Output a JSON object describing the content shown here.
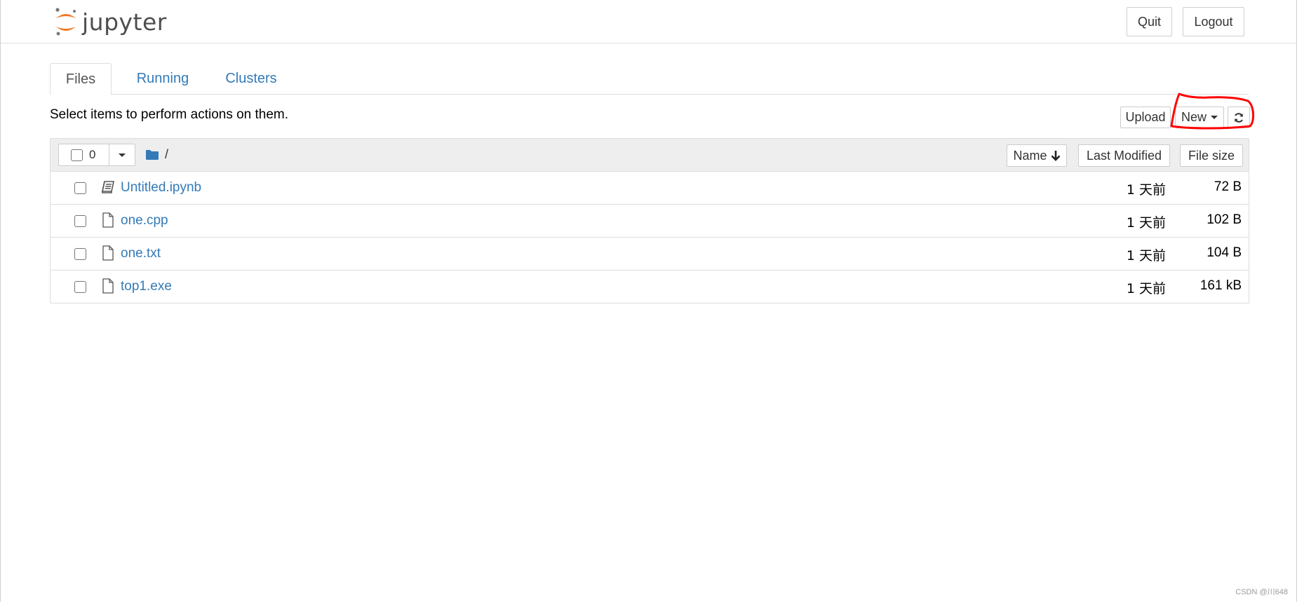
{
  "header": {
    "logo_text": "jupyter",
    "quit_label": "Quit",
    "logout_label": "Logout"
  },
  "tabs": [
    {
      "label": "Files",
      "active": true
    },
    {
      "label": "Running",
      "active": false
    },
    {
      "label": "Clusters",
      "active": false
    }
  ],
  "toolbar": {
    "instructions": "Select items to perform actions on them.",
    "upload_label": "Upload",
    "new_label": "New",
    "refresh_icon": "refresh-icon"
  },
  "list_header": {
    "selected_count": "0",
    "breadcrumb": "/",
    "sort_name_label": "Name",
    "sort_modified_label": "Last Modified",
    "sort_size_label": "File size"
  },
  "files": [
    {
      "name": "Untitled.ipynb",
      "icon": "notebook-icon",
      "modified": "1 天前",
      "size": "72 B"
    },
    {
      "name": "one.cpp",
      "icon": "file-icon",
      "modified": "1 天前",
      "size": "102 B"
    },
    {
      "name": "one.txt",
      "icon": "file-icon",
      "modified": "1 天前",
      "size": "104 B"
    },
    {
      "name": "top1.exe",
      "icon": "file-icon",
      "modified": "1 天前",
      "size": "161 kB"
    }
  ],
  "watermark": "CSDN @川648",
  "colors": {
    "link": "#337ab7",
    "header_bg": "#eeeeee",
    "annotation": "#ff0000",
    "logo_orange": "#f37626"
  }
}
